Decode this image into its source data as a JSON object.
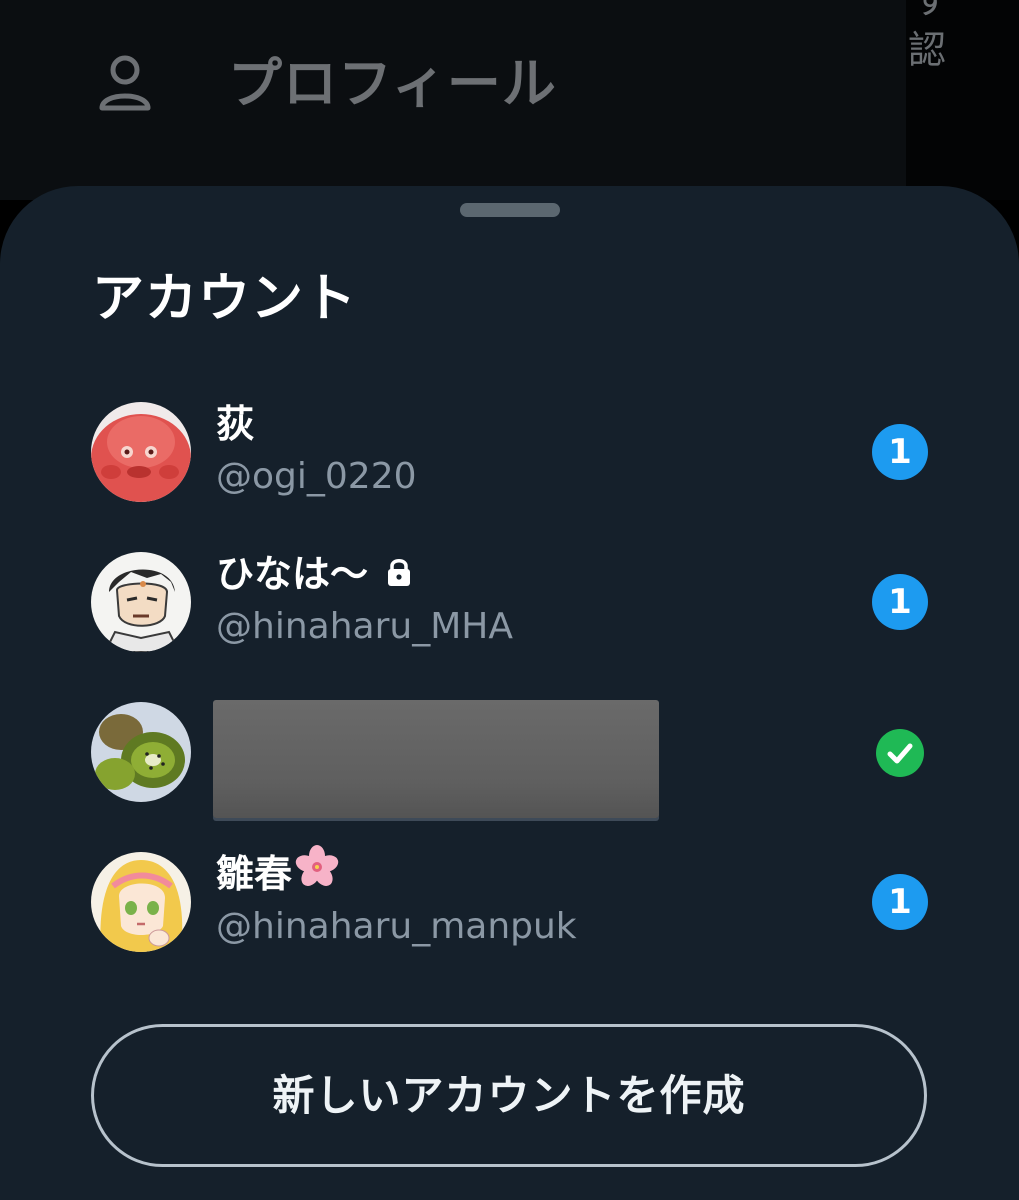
{
  "background": {
    "drawer_item_label": "プロフィール",
    "drawer_item_icon": "person-icon",
    "right_edge_fragment_top": "す",
    "right_edge_fragment": "認"
  },
  "sheet": {
    "title": "アカウント",
    "accounts": [
      {
        "display_name": "荻",
        "handle": "@ogi_0220",
        "badge": "1",
        "avatar_icon": "avatar-red-face-icon"
      },
      {
        "display_name": "ひなは〜",
        "handle": "@hinaharu_MHA",
        "badge": "1",
        "protected_icon": "lock-icon",
        "avatar_icon": "avatar-anime-man-icon"
      },
      {
        "display_name": "",
        "handle": "",
        "status": "current-account",
        "status_icon": "check-icon",
        "avatar_icon": "avatar-kiwi-icon"
      },
      {
        "display_name": "雛春",
        "name_emoji": "cherry-blossom-icon",
        "handle": "@hinaharu_manpuk",
        "badge": "1",
        "avatar_icon": "avatar-anime-girl-icon"
      }
    ],
    "create_button_label": "新しいアカウントを作成"
  },
  "colors": {
    "sheet_background": "#15202b",
    "badge_blue": "#1d9bf0",
    "check_green": "#1fb955",
    "handle_gray": "#8b98a5"
  }
}
